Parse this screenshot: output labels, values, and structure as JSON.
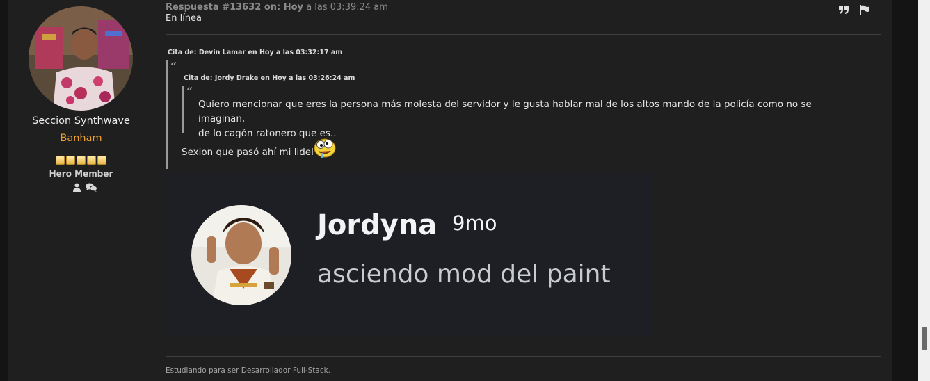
{
  "poster": {
    "name": "Seccion Synthwave",
    "group": "Banham",
    "rank": "Hero Member",
    "stars": 5,
    "icons": [
      "profile-icon",
      "messages-icon"
    ]
  },
  "post": {
    "header_prefix": "Respuesta #13632 on: Hoy",
    "header_time": "a las 03:39:24 am",
    "status": "En línea",
    "actions": [
      "quote-icon",
      "flag-icon"
    ]
  },
  "quote_outer": {
    "cite": "Cita de: Devin Lamar en Hoy a las 03:32:17 am"
  },
  "quote_inner": {
    "cite": "Cita de: Jordy Drake en Hoy a las 03:26:24 am",
    "line1": "Quiero mencionar que eres la persona más molesta del servidor y le gusta hablar mal de los altos mando de la policía como no se imaginan,",
    "line2": "de lo cagón ratonero que es.."
  },
  "reply": {
    "text": "Sexion que pasó ahí mi lidel",
    "emoji": "crazy-smiley-icon"
  },
  "embed": {
    "name": "Jordyna",
    "time": "9mo",
    "message": "asciendo mod del paint",
    "background": "#1e1f25"
  },
  "signature": "Estudiando para ser Desarrollador Full-Stack.",
  "colors": {
    "group_color": "#f0a030",
    "page_bg": "#141414",
    "card_bg": "#1f1f1f"
  }
}
